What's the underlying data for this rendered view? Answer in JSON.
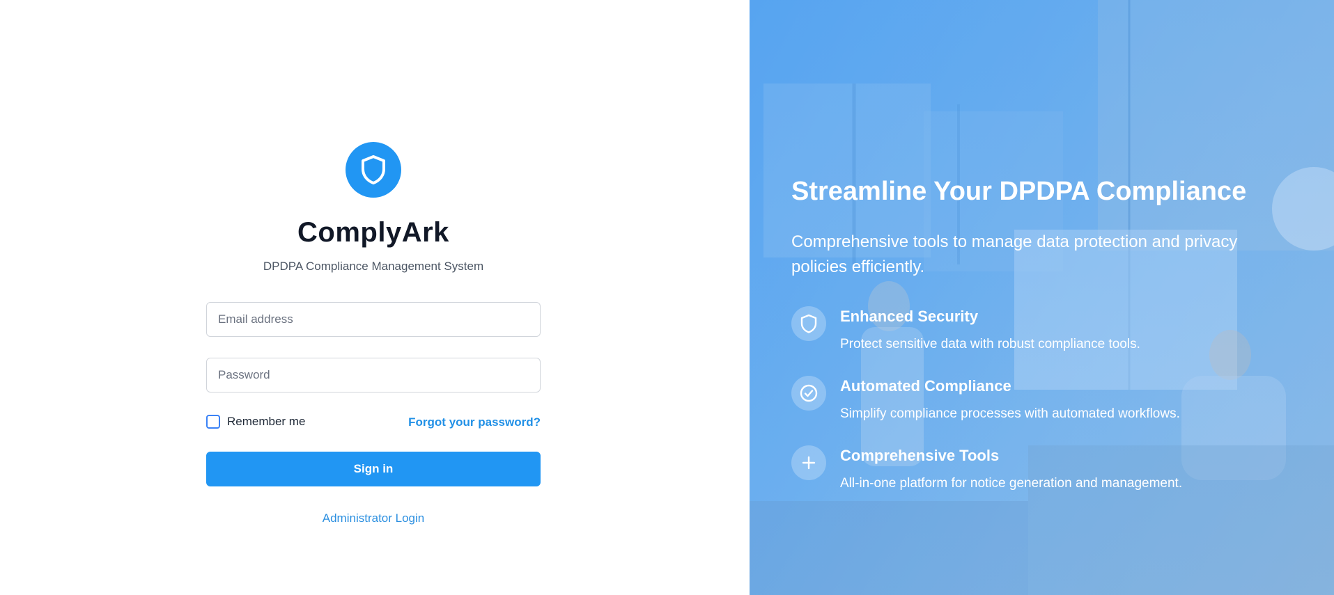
{
  "app": {
    "name": "ComplyArk",
    "tagline": "DPDPA Compliance Management System",
    "logo_icon": "shield-icon",
    "accent_color": "#2196f3"
  },
  "login_form": {
    "email_placeholder": "Email address",
    "password_placeholder": "Password",
    "remember_label": "Remember me",
    "remember_checked": false,
    "forgot_label": "Forgot your password?",
    "signin_label": "Sign in",
    "admin_login_label": "Administrator Login"
  },
  "hero": {
    "title": "Streamline Your DPDPA Compliance",
    "subtitle": "Comprehensive tools to manage data protection and privacy policies efficiently.",
    "features": [
      {
        "icon": "shield-icon",
        "title": "Enhanced Security",
        "description": "Protect sensitive data with robust compliance tools."
      },
      {
        "icon": "check-circle-icon",
        "title": "Automated Compliance",
        "description": "Simplify compliance processes with automated workflows."
      },
      {
        "icon": "plus-icon",
        "title": "Comprehensive Tools",
        "description": "All-in-one platform for notice generation and management."
      }
    ]
  }
}
